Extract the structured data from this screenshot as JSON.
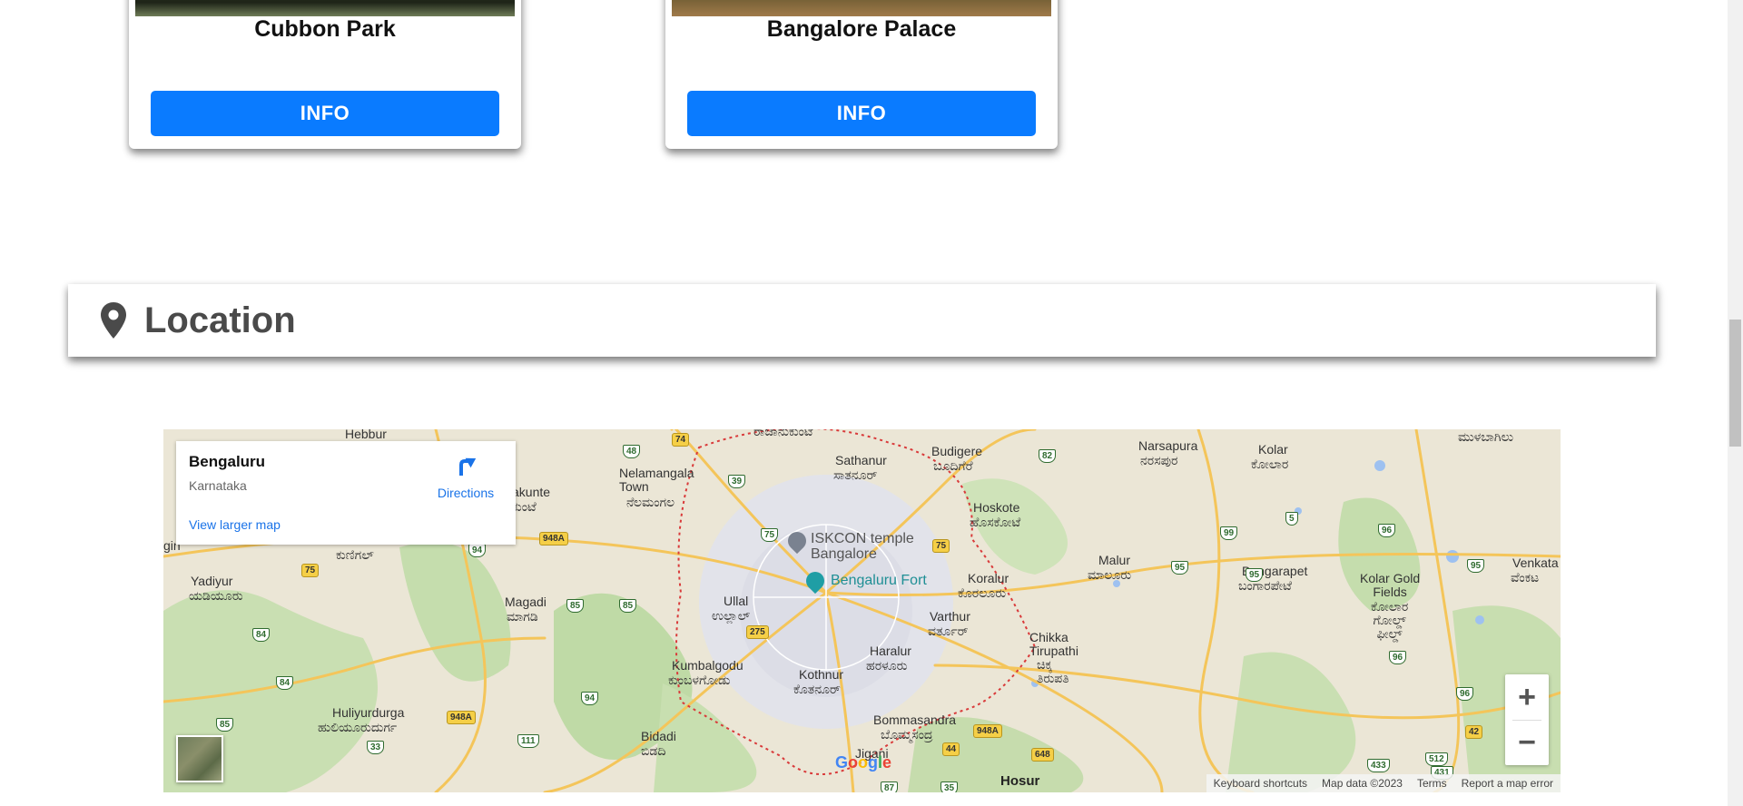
{
  "cards": [
    {
      "title": "Cubbon Park",
      "button": "INFO"
    },
    {
      "title": "Bangalore Palace",
      "button": "INFO"
    }
  ],
  "location": {
    "title": "Location",
    "icon": "map-marker-icon"
  },
  "map": {
    "info": {
      "place": "Bengaluru",
      "region": "Karnataka",
      "directions": "Directions",
      "larger_map": "View larger map"
    },
    "labels": {
      "hebbur": "Hebbur",
      "nelamangala_en": "Nelamangala\nTown",
      "nelamangala_kn": "ನೆಲಮಂಗಲ",
      "sathanur_en": "Sathanur",
      "sathanur_kn": "ಸಾತನೂರ್",
      "budigere_en": "Budigere",
      "budigere_kn": "ಬೂದಿಗೆರೆ",
      "hoskote_en": "Hoskote",
      "hoskote_kn": "ಹೊಸಕೋಟೆ",
      "narsapura_en": "Narsapura",
      "narsapura_kn": "ನರಸಪುರ",
      "kolar_en": "Kolar",
      "kolar_kn": "ಕೋಲಾರ",
      "mulbagal_kn": "ಮುಳಬಾಗಿಲು",
      "dabaspet_en": "akunte",
      "dabaspet_kn": "ಕುಂಟೆ",
      "kunigal_kn": "ಕುಣಿಗಲ್",
      "yadiyur_en": "Yadiyur",
      "yadiyur_kn": "ಯಡಿಯೂರು",
      "magadi_en": "Magadi",
      "magadi_kn": "ಮಾಗಡಿ",
      "ullal_en": "Ullal",
      "ullal_kn": "ಉಲ್ಲಾಲ್",
      "koralur_en": "Koralur",
      "koralur_kn": "ಕೊರಲೂರು",
      "malur_en": "Malur",
      "malur_kn": "ಮಾಲೂರು",
      "bangarapet_en": "Bangarapet",
      "bangarapet_kn": "ಬಂಗಾರಪೇಟೆ",
      "kgf_en": "Kolar Gold\nFields",
      "kgf_kn": "ಕೋಲಾರ\nಗೋಲ್ಡ್\nಫೀಲ್ಡ್",
      "venkata": "Venkata",
      "venkata_kn": "ವೆಂಕಟ",
      "varthur_en": "Varthur",
      "varthur_kn": "ವರ್ತೂರ್",
      "chikka_en": "Chikka\nTirupathi",
      "chikka_kn": "ಚಿಕ್ಕ\nತಿರುಪತಿ",
      "haralur_en": "Haralur",
      "haralur_kn": "ಹರಳೂರು",
      "kumbalgodu_en": "Kumbalgodu",
      "kumbalgodu_kn": "ಕುಂಬಳಗೋಡು",
      "kothnur_en": "Kothnur",
      "kothnur_kn": "ಕೊತನೂರ್",
      "huliyurdurga_en": "Huliyurdurga",
      "huliyurdurga_kn": "ಹುಲಿಯೂರುದುರ್ಗ",
      "bidadi_en": "Bidadi",
      "bidadi_kn": "ಬಿಡದಿ",
      "bommasandra_en": "Bommasandra",
      "bommasandra_kn": "ಬೊಮ್ಮಸಂದ್ರ",
      "jigani": "Jigani",
      "hosur": "Hosur",
      "gin": "gin",
      "top_kn": "ರಾಜಾನುಕುಂಟೆ"
    },
    "pois": {
      "iskcon": "ISKCON temple\nBangalore",
      "fort": "Bengaluru Fort"
    },
    "shields": [
      "74",
      "48",
      "39",
      "82",
      "75",
      "75",
      "948A",
      "94",
      "75",
      "85",
      "85",
      "275",
      "84",
      "84",
      "94",
      "948A",
      "111",
      "33",
      "85",
      "44",
      "648",
      "948A",
      "87",
      "35",
      "99",
      "95",
      "95",
      "5",
      "96",
      "96",
      "95",
      "96",
      "42",
      "512",
      "433",
      "431"
    ],
    "zoom": {
      "in": "+",
      "out": "−"
    },
    "google": "Google",
    "attribution": {
      "shortcuts": "Keyboard shortcuts",
      "data": "Map data ©2023",
      "terms": "Terms",
      "report": "Report a map error"
    }
  }
}
